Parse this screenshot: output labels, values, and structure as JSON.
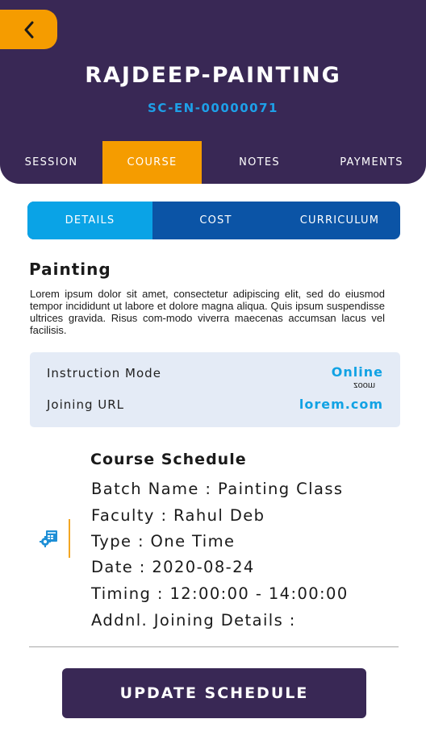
{
  "header": {
    "title": "RAJDEEP-PAINTING",
    "code": "SC-EN-00000071",
    "back_icon": "chevron-left-icon"
  },
  "tabs": [
    {
      "label": "SESSION",
      "active": false
    },
    {
      "label": "COURSE",
      "active": true
    },
    {
      "label": "NOTES",
      "active": false
    },
    {
      "label": "PAYMENTS",
      "active": false
    }
  ],
  "subtabs": [
    {
      "label": "DETAILS",
      "active": true
    },
    {
      "label": "COST",
      "active": false
    },
    {
      "label": "CURRICULUM",
      "active": false
    }
  ],
  "course": {
    "name": "Painting",
    "description": "Lorem ipsum dolor sit amet, consectetur adipiscing elit, sed do eiusmod tempor incididunt ut labore et dolore magna aliqua. Quis ipsum suspendisse ultrices gravida. Risus com-modo viverra maecenas accumsan lacus vel facilisis."
  },
  "info": {
    "instruction_mode_label": "Instruction Mode",
    "instruction_mode_value": "Online",
    "instruction_mode_sub": "zoom",
    "joining_url_label": "Joining URL",
    "joining_url_value": "lorem.com"
  },
  "schedule": {
    "title": "Course Schedule",
    "batch": "Batch Name : Painting Class",
    "faculty": "Faculty : Rahul Deb",
    "type": "Type : One Time",
    "date": "Date : 2020-08-24",
    "timing": "Timing : 12:00:00 - 14:00:00",
    "addnl": "Addnl. Joining Details :",
    "icon": "schedule-settings-icon"
  },
  "actions": {
    "update_label": "UPDATE SCHEDULE"
  },
  "colors": {
    "header_bg": "#392855",
    "accent_orange": "#f59c00",
    "accent_blue": "#11a2e4",
    "subtab_active": "#0aa3e6",
    "subtab_bg": "#0b54a6",
    "info_bg": "#e4ebf6"
  }
}
